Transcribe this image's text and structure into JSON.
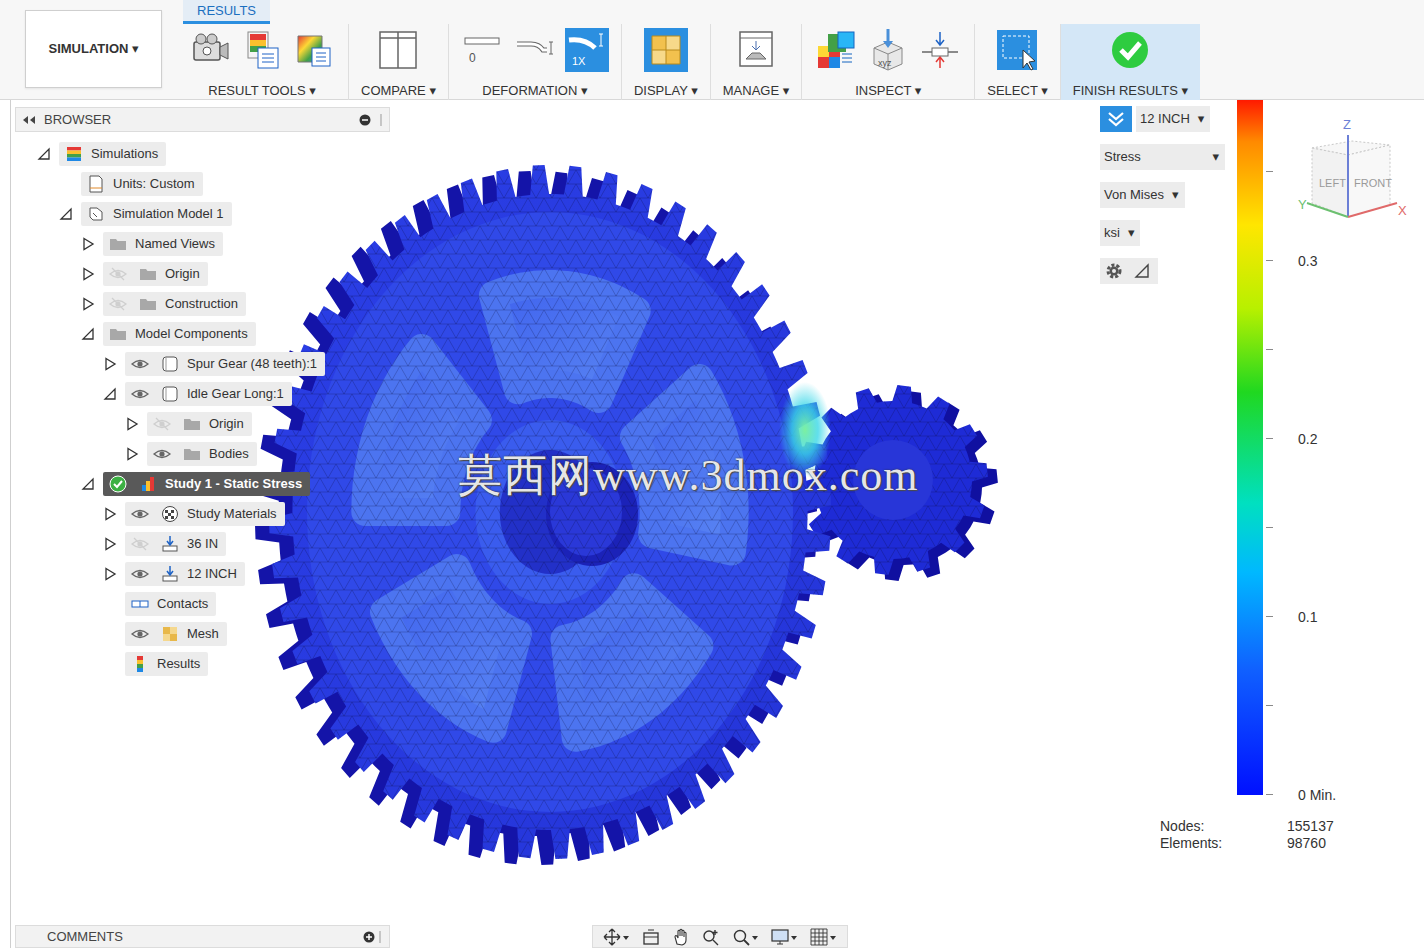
{
  "toolbar": {
    "workspace": {
      "label": "SIMULATION ▾"
    },
    "tabs": [
      {
        "label": "RESULTS",
        "selected": true
      }
    ],
    "groups": [
      {
        "label": "RESULT TOOLS ▾",
        "highlighted": false,
        "tools": [
          {
            "selected": false
          },
          {
            "selected": false
          },
          {
            "selected": false
          }
        ]
      },
      {
        "label": "COMPARE ▾",
        "highlighted": false,
        "tools": [
          {
            "selected": false
          }
        ]
      },
      {
        "label": "DEFORMATION ▾",
        "highlighted": false,
        "tools": [
          {
            "selected": false,
            "text": "0"
          },
          {
            "selected": false
          },
          {
            "selected": true,
            "text": "1X"
          }
        ]
      },
      {
        "label": "DISPLAY ▾",
        "highlighted": false,
        "tools": [
          {
            "selected": true
          }
        ]
      },
      {
        "label": "MANAGE ▾",
        "highlighted": false,
        "tools": [
          {
            "selected": false
          }
        ]
      },
      {
        "label": "INSPECT ▾",
        "highlighted": false,
        "tools": [
          {
            "selected": false
          },
          {
            "selected": false,
            "text": "xyz"
          },
          {
            "selected": false
          }
        ]
      },
      {
        "label": "SELECT ▾",
        "highlighted": false,
        "tools": [
          {
            "selected": false
          }
        ]
      },
      {
        "label": "FINISH RESULTS ▾",
        "highlighted": true,
        "tools": [
          {
            "selected": false
          }
        ]
      }
    ]
  },
  "browser": {
    "title": "BROWSER",
    "items": [
      {
        "label": "Simulations",
        "depth": 0,
        "expander": "open",
        "eye": "none",
        "icon": "simulations",
        "selected": false
      },
      {
        "label": "Units: Custom",
        "depth": 1,
        "expander": "none",
        "eye": "none",
        "icon": "units",
        "selected": false
      },
      {
        "label": "Simulation Model 1",
        "depth": 1,
        "expander": "open",
        "eye": "none",
        "icon": "model",
        "selected": false
      },
      {
        "label": "Named Views",
        "depth": 2,
        "expander": "closed",
        "eye": "none",
        "icon": "folder",
        "selected": false
      },
      {
        "label": "Origin",
        "depth": 2,
        "expander": "closed",
        "eye": "off",
        "icon": "folder",
        "selected": false
      },
      {
        "label": "Construction",
        "depth": 2,
        "expander": "closed",
        "eye": "off",
        "icon": "folder",
        "selected": false
      },
      {
        "label": "Model Components",
        "depth": 2,
        "expander": "open",
        "eye": "none",
        "icon": "folder",
        "selected": false
      },
      {
        "label": "Spur Gear (48 teeth):1",
        "depth": 3,
        "expander": "closed",
        "eye": "on",
        "icon": "body",
        "selected": false
      },
      {
        "label": "Idle Gear Long:1",
        "depth": 3,
        "expander": "open",
        "eye": "on",
        "icon": "body",
        "selected": false
      },
      {
        "label": "Origin",
        "depth": 4,
        "expander": "closed",
        "eye": "off",
        "icon": "folder",
        "selected": false
      },
      {
        "label": "Bodies",
        "depth": 4,
        "expander": "closed",
        "eye": "on",
        "icon": "folder",
        "selected": false
      },
      {
        "label": "Study 1 - Static Stress",
        "depth": 2,
        "expander": "open",
        "eye": "active",
        "icon": "study",
        "selected": true
      },
      {
        "label": "Study Materials",
        "depth": 3,
        "expander": "closed",
        "eye": "on",
        "icon": "materials",
        "selected": false
      },
      {
        "label": "36 IN",
        "depth": 3,
        "expander": "closed",
        "eye": "off",
        "icon": "load",
        "selected": false
      },
      {
        "label": "12 INCH",
        "depth": 3,
        "expander": "closed",
        "eye": "on",
        "icon": "load",
        "selected": false
      },
      {
        "label": "Contacts",
        "depth": 3,
        "expander": "none",
        "eye": "none",
        "icon": "contacts",
        "selected": false
      },
      {
        "label": "Mesh",
        "depth": 3,
        "expander": "none",
        "eye": "on",
        "icon": "mesh",
        "selected": false
      },
      {
        "label": "Results",
        "depth": 3,
        "expander": "none",
        "eye": "none",
        "icon": "results",
        "selected": false
      }
    ]
  },
  "result_controls": [
    {
      "text": "12 INCH",
      "arrow": "▾"
    },
    {
      "text": "Stress",
      "arrow": "▾"
    },
    {
      "text": "Von Mises",
      "arrow": "▾"
    },
    {
      "text": "ksi",
      "arrow": "▾"
    }
  ],
  "legend": {
    "ticks": [
      {
        "label": "0.3",
        "level": 0.768
      },
      {
        "label": "0.2",
        "level": 0.512
      },
      {
        "label": "0.1",
        "level": 0.256
      },
      {
        "label": "0 Min.",
        "level": 0
      }
    ]
  },
  "view_cube": {
    "faces": [
      "LEFT",
      "FRONT"
    ],
    "axes": [
      {
        "label": "Z"
      },
      {
        "label": "X"
      },
      {
        "label": "Y"
      }
    ]
  },
  "stats": [
    {
      "label": "Nodes:",
      "value": "155137"
    },
    {
      "label": "Elements:",
      "value": "98760"
    }
  ],
  "watermark": "莫西网www.3dmox.com",
  "comments": {
    "title": "COMMENTS"
  }
}
